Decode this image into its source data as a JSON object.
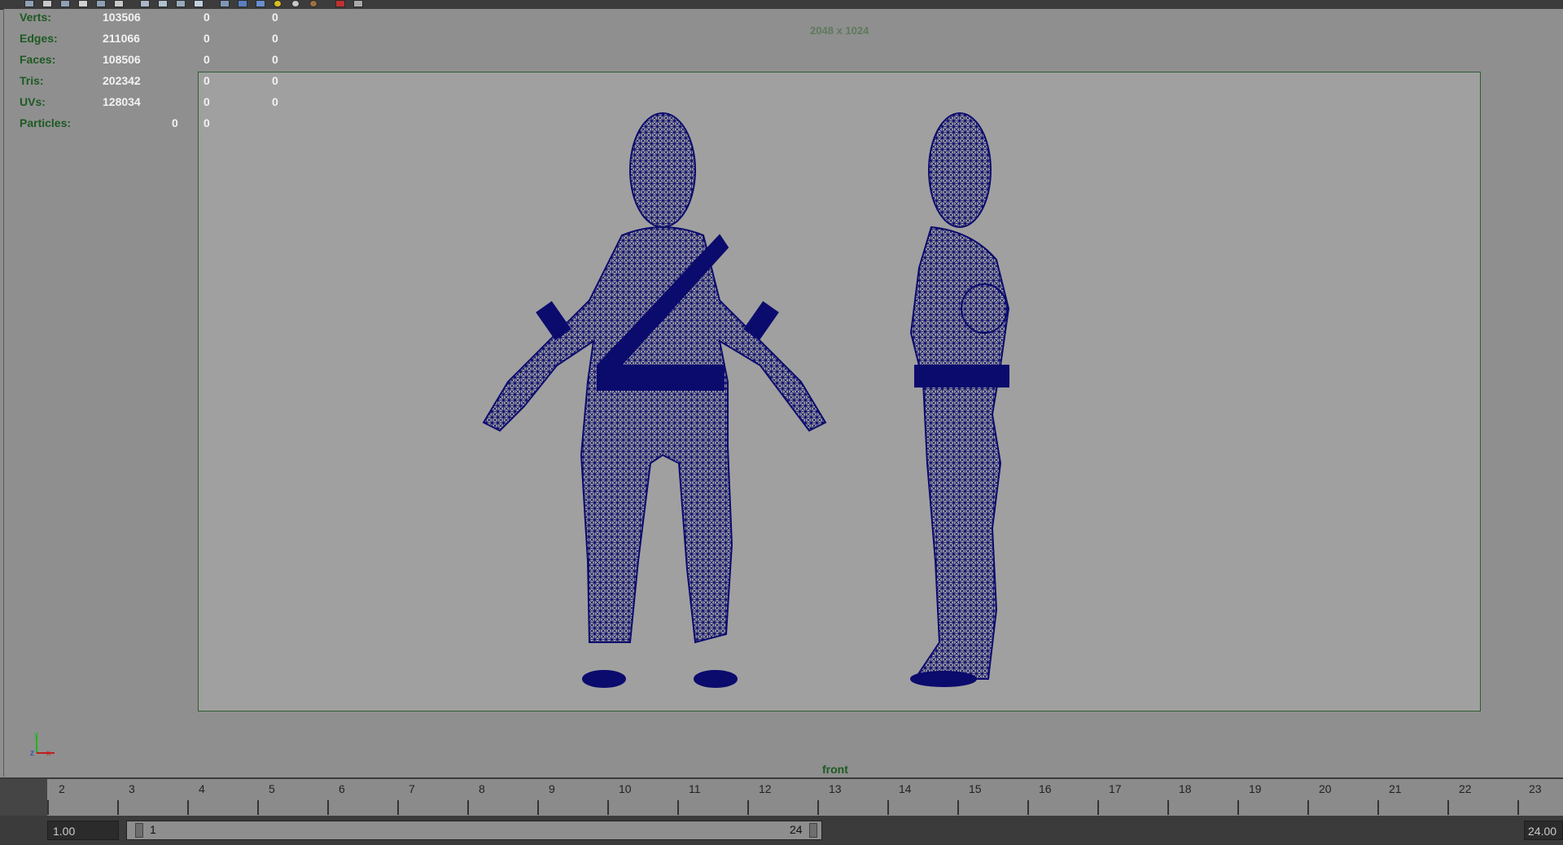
{
  "toolbar": {
    "icons": [
      "tool-icon",
      "tool-icon",
      "render-icon",
      "render-icon",
      "camera-icon",
      "paint-icon",
      "grid-icon",
      "film-gate-icon",
      "resolution-gate-icon",
      "safe-action-icon",
      "wireframe-icon",
      "smooth-shade-icon",
      "texture-icon",
      "light-icon",
      "shadow-icon",
      "xray-icon",
      "isolate-icon",
      "layout-icon"
    ]
  },
  "hud": {
    "rows": [
      {
        "label": "Verts:",
        "v1": "103506",
        "v2": "0",
        "v3": "0"
      },
      {
        "label": "Edges:",
        "v1": "211066",
        "v2": "0",
        "v3": "0"
      },
      {
        "label": "Faces:",
        "v1": "108506",
        "v2": "0",
        "v3": "0"
      },
      {
        "label": "Tris:",
        "v1": "202342",
        "v2": "0",
        "v3": "0"
      },
      {
        "label": "UVs:",
        "v1": "128034",
        "v2": "0",
        "v3": "0"
      },
      {
        "label": "Particles:",
        "v1": "0",
        "v2": "0"
      }
    ]
  },
  "viewport": {
    "resolution": "2048 x 1024",
    "camera": "front",
    "axis": {
      "y": "y",
      "z": "z",
      "x": "x"
    },
    "wire_color": "#0b0b6e"
  },
  "timeline": {
    "ticks": [
      "2",
      "3",
      "4",
      "5",
      "6",
      "7",
      "8",
      "9",
      "10",
      "11",
      "12",
      "13",
      "14",
      "15",
      "16",
      "17",
      "18",
      "19",
      "20",
      "21",
      "22",
      "23"
    ]
  },
  "range": {
    "start_time": "1.00",
    "range_start": "1",
    "range_end": "24",
    "end_time": "24.00"
  }
}
